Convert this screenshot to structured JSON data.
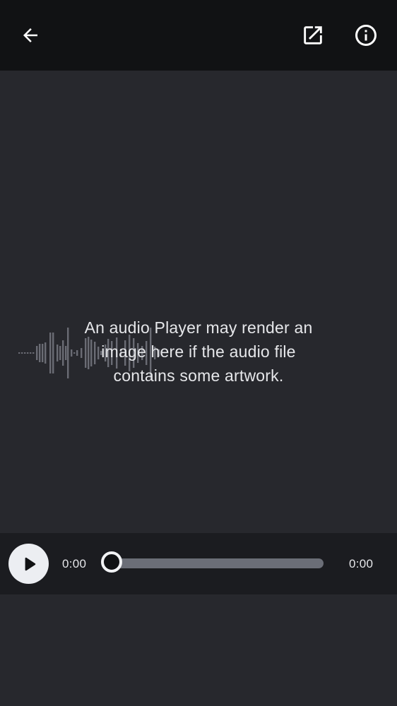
{
  "topbar": {
    "icons": {
      "back": "arrow-back-icon",
      "open_external": "open-in-new-icon",
      "info": "info-icon"
    }
  },
  "artwork": {
    "placeholder_lines": [
      "An audio Player may render an",
      "image here if the audio file",
      "contains some artwork."
    ],
    "waveform_icon": "waveform-icon"
  },
  "player": {
    "play_icon": "play-icon",
    "current_time": "0:00",
    "total_time": "0:00",
    "progress": 0
  },
  "colors": {
    "topbar_bg": "#111214",
    "content_bg": "#27282d",
    "player_bg": "#1b1c20",
    "text": "#e6e7ea",
    "play_button_bg": "#eceef2",
    "seek_track": "#6b6e77"
  }
}
